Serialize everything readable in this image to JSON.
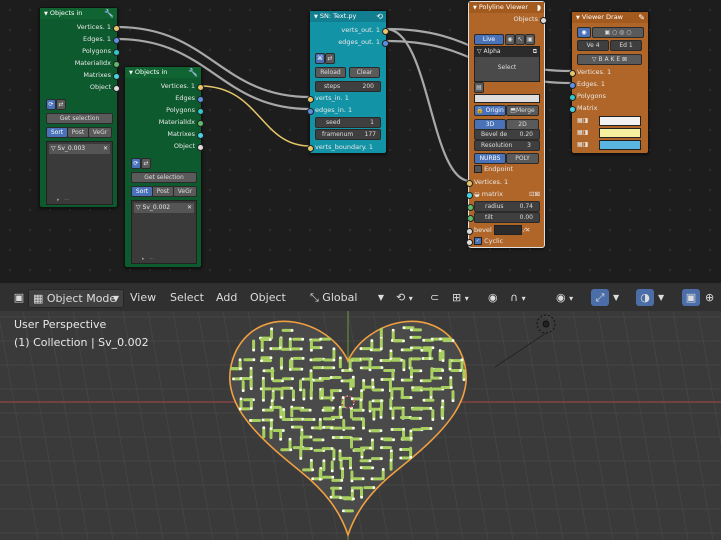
{
  "objects_in_1": {
    "title": "Objects in",
    "outputs": [
      "Vertices. 1",
      "Edges. 1",
      "Polygons",
      "MaterialIdx",
      "Matrixes",
      "Object"
    ],
    "get_selection": "Get selection",
    "tabs": [
      "Sort",
      "Post",
      "VeGr"
    ],
    "item": "Sv_0.003"
  },
  "objects_in_2": {
    "title": "Objects in",
    "outputs": [
      "Vertices. 1",
      "Edges",
      "Polygons",
      "MaterialIdx",
      "Matrixes",
      "Object"
    ],
    "get_selection": "Get selection",
    "tabs": [
      "Sort",
      "Post",
      "VeGr"
    ],
    "item": "Sv_0.002"
  },
  "sn_text": {
    "title": "SN: Text.py",
    "outputs": [
      "verts_out. 1",
      "edges_out. 1"
    ],
    "reload": "Reload",
    "clear": "Clear",
    "steps_label": "steps",
    "steps": "200",
    "inputs": [
      "verts_in. 1",
      "edges_in. 1"
    ],
    "seed_label": "seed",
    "seed": "1",
    "framenum_label": "framenum",
    "framenum": "177",
    "verts_boundary": "verts_boundary. 1"
  },
  "polyline": {
    "title": "Polyline Viewer",
    "objects": "Objects",
    "live": "Live",
    "alpha": "Alpha",
    "select": "Select",
    "origin": "Origin",
    "merge": "Merge",
    "mode_3d": "3D",
    "mode_2d": "2D",
    "bevel_depth_label": "Bevel de",
    "bevel_depth": "0.20",
    "resolution_label": "Resolution",
    "resolution": "3",
    "nurbs": "NURBS",
    "poly": "POLY",
    "endpoint": "Endpoint",
    "vertices": "Vertices. 1",
    "matrix": "matrix",
    "radius_label": "radius",
    "radius": "0.74",
    "tilt_label": "tilt",
    "tilt": "0.00",
    "bevel": "bevel",
    "cyclic": "Cyclic"
  },
  "viewer_draw": {
    "title": "Viewer Draw",
    "ve_label": "Ve",
    "ve": "4",
    "ed_label": "Ed",
    "ed": "1",
    "bake": "B A K E",
    "inputs": [
      "Vertices. 1",
      "Edges. 1",
      "Polygons",
      "Matrix"
    ]
  },
  "toolbar": {
    "mode": "Object Mode",
    "menus": [
      "View",
      "Select",
      "Add",
      "Object"
    ],
    "orientation": "Global"
  },
  "viewport": {
    "perspective": "User Perspective",
    "collection": "(1) Collection | Sv_0.002"
  },
  "colors": {
    "object_nodes": "#0f6432",
    "script_node": "#1293a6",
    "viewer_nodes": "#b06628",
    "selected_outline": "#f0a040",
    "edges": "#a8d060"
  }
}
